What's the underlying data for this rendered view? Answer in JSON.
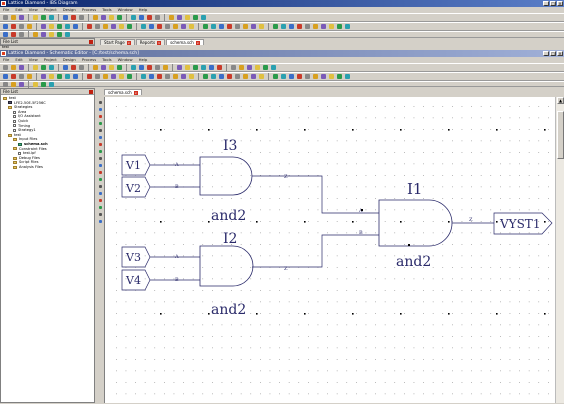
{
  "outer_window": {
    "title": "Lattice Diamond - IBS Diagram",
    "menu": [
      "File",
      "Edit",
      "View",
      "Project",
      "Design",
      "Process",
      "Tools",
      "Window",
      "Help"
    ],
    "tabs": [
      {
        "label": "Start Page",
        "active": false
      },
      {
        "label": "Reports",
        "active": false
      },
      {
        "label": "schema.sch",
        "active": true
      }
    ]
  },
  "inner_window": {
    "title": "Lattice Diamond - Schematic Editor - [C:/test/schema.sch]",
    "menu": [
      "File",
      "Edit",
      "View",
      "Project",
      "Design",
      "Process",
      "Tools",
      "Window",
      "Help"
    ],
    "tab": {
      "label": "schema.sch"
    }
  },
  "outer_file_list": {
    "header": "File List",
    "item": "test"
  },
  "file_list": {
    "header": "File List",
    "items": [
      {
        "label": "test",
        "level": 0,
        "icon": "folder"
      },
      {
        "label": "LFE2-50E-5F256C",
        "level": 1,
        "icon": "chip"
      },
      {
        "label": "Strategies",
        "level": 1,
        "icon": "folder"
      },
      {
        "label": "Area",
        "level": 2,
        "icon": "file"
      },
      {
        "label": "I/O Assistant",
        "level": 2,
        "icon": "file"
      },
      {
        "label": "Quick",
        "level": 2,
        "icon": "file"
      },
      {
        "label": "Timing",
        "level": 2,
        "icon": "file"
      },
      {
        "label": "Strategy1",
        "level": 2,
        "icon": "file"
      },
      {
        "label": "test",
        "level": 1,
        "icon": "folder"
      },
      {
        "label": "Input Files",
        "level": 2,
        "icon": "folder"
      },
      {
        "label": "schema.sch",
        "level": 3,
        "icon": "gate"
      },
      {
        "label": "Constraint Files",
        "level": 2,
        "icon": "folder"
      },
      {
        "label": "test.lpf",
        "level": 3,
        "icon": "file"
      },
      {
        "label": "Debug Files",
        "level": 2,
        "icon": "folder"
      },
      {
        "label": "Script Files",
        "level": 2,
        "icon": "folder"
      },
      {
        "label": "Analysis Files",
        "level": 2,
        "icon": "folder"
      }
    ]
  },
  "schematic": {
    "gates": [
      {
        "instance": "I3",
        "type": "and2",
        "in_a": "A",
        "in_b": "B",
        "out": "Z"
      },
      {
        "instance": "I2",
        "type": "and2",
        "in_a": "A",
        "in_b": "B",
        "out": "Z"
      },
      {
        "instance": "I1",
        "type": "and2",
        "in_a": "A",
        "in_b": "B",
        "out": "Z"
      }
    ],
    "inputs": [
      "V1",
      "V2",
      "V3",
      "V4"
    ],
    "output": "VYST1"
  }
}
